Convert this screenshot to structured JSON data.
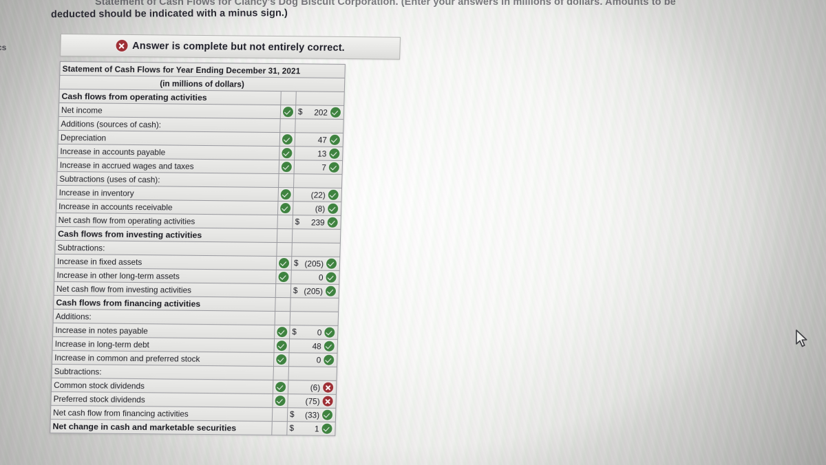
{
  "question": {
    "line1_clipped": "Statement of Cash Flows for Clancy's Dog Biscuit Corporation. (Enter your answers in millions of dollars. Amounts to be",
    "line2": "deducted should be indicated with a minus sign.)",
    "edge_fragment": "cs"
  },
  "banner": {
    "icon": "x-circle-icon",
    "text": "Answer is complete but not entirely correct."
  },
  "statement": {
    "title": "Statement of Cash Flows for Year Ending December 31, 2021",
    "subtitle": "(in millions of dollars)",
    "rows": [
      {
        "label": "Cash flows from operating activities",
        "indent": 0,
        "bold": true,
        "check": "",
        "currency": "",
        "value": "",
        "status": ""
      },
      {
        "label": "Net income",
        "indent": 1,
        "bold": false,
        "check": "ok",
        "currency": "$",
        "value": "202",
        "status": "ok"
      },
      {
        "label": "Additions (sources of cash):",
        "indent": 1,
        "bold": false,
        "check": "",
        "currency": "",
        "value": "",
        "status": ""
      },
      {
        "label": "Depreciation",
        "indent": 2,
        "bold": false,
        "check": "ok",
        "currency": "",
        "value": "47",
        "status": "ok"
      },
      {
        "label": "Increase in accounts payable",
        "indent": 3,
        "bold": false,
        "check": "ok",
        "currency": "",
        "value": "13",
        "status": "ok"
      },
      {
        "label": "Increase in accrued wages and taxes",
        "indent": 3,
        "bold": false,
        "check": "ok",
        "currency": "",
        "value": "7",
        "status": "ok"
      },
      {
        "label": "Subtractions (uses of cash):",
        "indent": 1,
        "bold": false,
        "check": "",
        "currency": "",
        "value": "",
        "status": ""
      },
      {
        "label": "Increase in inventory",
        "indent": 2,
        "bold": false,
        "check": "ok",
        "currency": "",
        "value": "(22)",
        "status": "ok"
      },
      {
        "label": "Increase in accounts receivable",
        "indent": 2,
        "bold": false,
        "check": "ok",
        "currency": "",
        "value": "(8)",
        "status": "ok"
      },
      {
        "label": "Net cash flow from operating activities",
        "indent": "net",
        "bold": false,
        "check": "",
        "currency": "$",
        "value": "239",
        "status": "ok"
      },
      {
        "label": "Cash flows from investing activities",
        "indent": 0,
        "bold": true,
        "check": "",
        "currency": "",
        "value": "",
        "status": ""
      },
      {
        "label": "Subtractions:",
        "indent": 1,
        "bold": false,
        "check": "",
        "currency": "",
        "value": "",
        "status": ""
      },
      {
        "label": "Increase in fixed assets",
        "indent": 2,
        "bold": false,
        "check": "ok",
        "currency": "$",
        "value": "(205)",
        "status": "ok"
      },
      {
        "label": "Increase in other long-term assets",
        "indent": 2,
        "bold": false,
        "check": "ok",
        "currency": "",
        "value": "0",
        "status": "ok"
      },
      {
        "label": "Net cash flow from investing activities",
        "indent": "net",
        "bold": false,
        "check": "",
        "currency": "$",
        "value": "(205)",
        "status": "ok"
      },
      {
        "label": "Cash flows from financing activities",
        "indent": 0,
        "bold": true,
        "check": "",
        "currency": "",
        "value": "",
        "status": ""
      },
      {
        "label": "Additions:",
        "indent": 1,
        "bold": false,
        "check": "",
        "currency": "",
        "value": "",
        "status": ""
      },
      {
        "label": "Increase in notes payable",
        "indent": 2,
        "bold": false,
        "check": "ok",
        "currency": "$",
        "value": "0",
        "status": "ok"
      },
      {
        "label": "Increase in long-term debt",
        "indent": 2,
        "bold": false,
        "check": "ok",
        "currency": "",
        "value": "48",
        "status": "ok"
      },
      {
        "label": "Increase in common and preferred stock",
        "indent": 3,
        "bold": false,
        "check": "ok",
        "currency": "",
        "value": "0",
        "status": "ok"
      },
      {
        "label": "Subtractions:",
        "indent": 1,
        "bold": false,
        "check": "",
        "currency": "",
        "value": "",
        "status": ""
      },
      {
        "label": "Common stock dividends",
        "indent": 2,
        "bold": false,
        "check": "ok",
        "currency": "",
        "value": "(6)",
        "status": "bad"
      },
      {
        "label": "Preferred stock dividends",
        "indent": 2,
        "bold": false,
        "check": "ok",
        "currency": "",
        "value": "(75)",
        "status": "bad"
      },
      {
        "label": "Net cash flow from financing activities",
        "indent": "net",
        "bold": false,
        "check": "",
        "currency": "$",
        "value": "(33)",
        "status": "ok"
      },
      {
        "label": "Net change in cash and marketable securities",
        "indent": 0,
        "bold": true,
        "check": "",
        "currency": "$",
        "value": "1",
        "status": "ok"
      }
    ]
  },
  "colors": {
    "correct_green": "#3f8340",
    "incorrect_red": "#9e2f35",
    "table_bg": "#e4e4e2",
    "table_border": "#9a9aa0",
    "text": "#1b1b22"
  },
  "cursor": {
    "name": "mouse-pointer"
  }
}
